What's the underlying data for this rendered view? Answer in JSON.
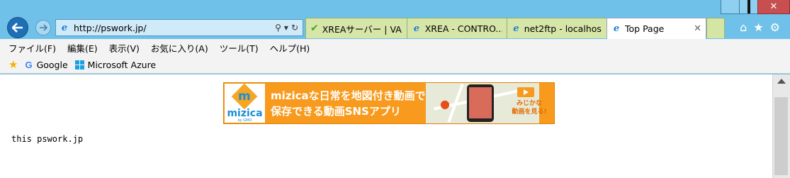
{
  "browser": {
    "address": {
      "url": "http://pswork.jp/"
    },
    "tabs": [
      {
        "label": "XREAサーバー | VA...",
        "icon": "check-icon"
      },
      {
        "label": "XREA - CONTRO...",
        "icon": "ie-page-icon"
      },
      {
        "label": "net2ftp - localhos...",
        "icon": "ie-page-icon"
      },
      {
        "label": "Top Page",
        "icon": "ie-page-icon",
        "active": true
      }
    ],
    "menu": [
      "ファイル(F)",
      "編集(E)",
      "表示(V)",
      "お気に入り(A)",
      "ツール(T)",
      "ヘルプ(H)"
    ],
    "favorites": [
      {
        "label": "Google",
        "icon": "google-icon"
      },
      {
        "label": "Microsoft Azure",
        "icon": "windows-icon"
      }
    ],
    "colors": {
      "frame": "#6fc1e9",
      "tab_inactive": "#d6e6a8",
      "back_button": "#1f6fb6"
    }
  },
  "page": {
    "banner": {
      "logo": "mizica",
      "line1": "mizicaな日常を地図付き動画で",
      "line2": "保存できる動画SNSアプリ",
      "cta_line1": "みじかな",
      "cta_line2": "動画を見る!",
      "color": "#f79a1d"
    },
    "text": "this pswork.jp"
  }
}
